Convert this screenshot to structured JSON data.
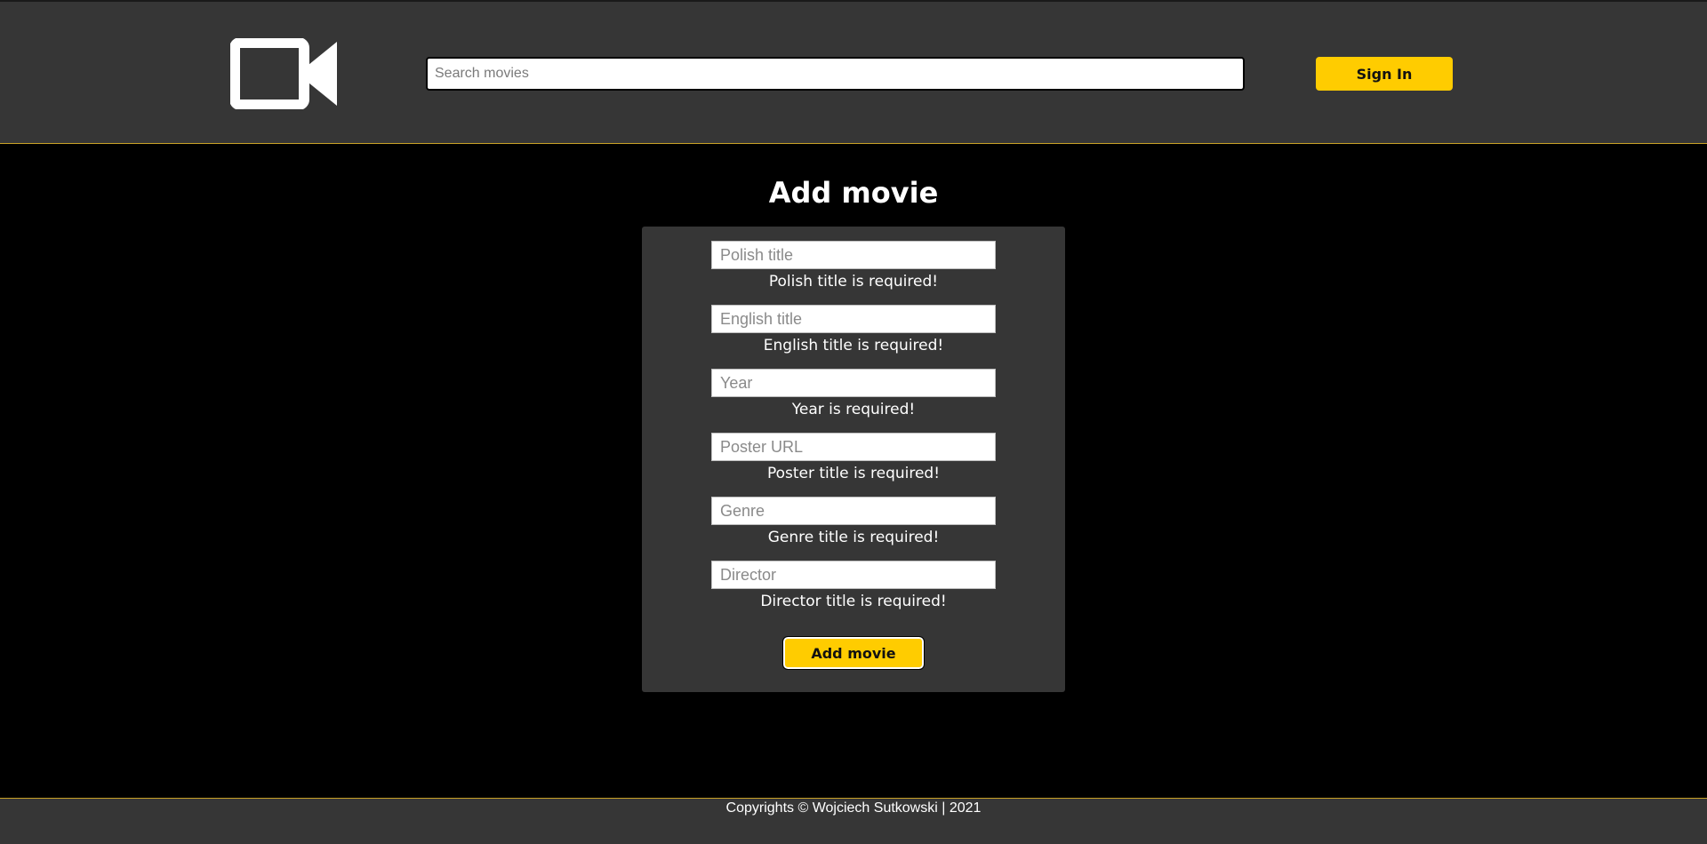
{
  "header": {
    "logo_icon": "video-camera-icon",
    "search": {
      "placeholder": "Search movies",
      "value": ""
    },
    "signin_label": "Sign In"
  },
  "main": {
    "title": "Add movie",
    "form": {
      "fields": [
        {
          "placeholder": "Polish title",
          "value": "",
          "error": "Polish title is required!"
        },
        {
          "placeholder": "English title",
          "value": "",
          "error": "English title is required!"
        },
        {
          "placeholder": "Year",
          "value": "",
          "error": "Year is required!"
        },
        {
          "placeholder": "Poster URL",
          "value": "",
          "error": "Poster title is required!"
        },
        {
          "placeholder": "Genre",
          "value": "",
          "error": "Genre title is required!"
        },
        {
          "placeholder": "Director",
          "value": "",
          "error": "Director title is required!"
        }
      ],
      "submit_label": "Add movie"
    }
  },
  "footer": {
    "copyright": "Copyrights © Wojciech Sutkowski | 2021"
  },
  "colors": {
    "accent": "#ffcc00",
    "panel": "#363636",
    "background": "#000000",
    "divider": "#c9a227"
  }
}
